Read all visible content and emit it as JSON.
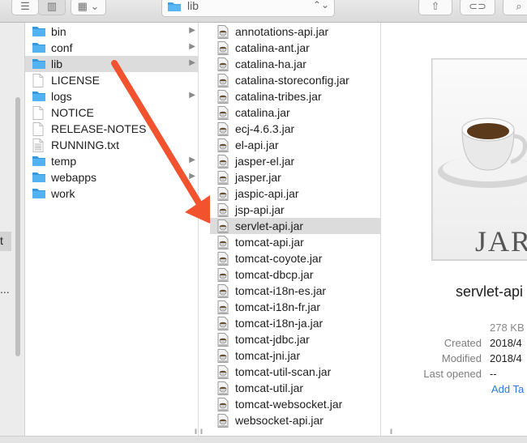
{
  "toolbar": {
    "path_name": "lib",
    "path_arrows": "◇",
    "list_view_icon": "list-view-icon",
    "column_view_icon": "column-view-icon",
    "gallery_icon": "gallery-view-icon",
    "share_icon": "share-icon",
    "tag_icon": "tag-icon",
    "search_icon": "search-icon"
  },
  "sidebar": {
    "selected_fragment": "t",
    "dots": "..."
  },
  "column1": [
    {
      "label": "bin",
      "type": "folder",
      "has_children": true
    },
    {
      "label": "conf",
      "type": "folder",
      "has_children": true
    },
    {
      "label": "lib",
      "type": "folder",
      "has_children": true,
      "selected": true
    },
    {
      "label": "LICENSE",
      "type": "file",
      "has_children": false
    },
    {
      "label": "logs",
      "type": "folder",
      "has_children": true
    },
    {
      "label": "NOTICE",
      "type": "file",
      "has_children": false
    },
    {
      "label": "RELEASE-NOTES",
      "type": "file",
      "has_children": false
    },
    {
      "label": "RUNNING.txt",
      "type": "textfile",
      "has_children": false
    },
    {
      "label": "temp",
      "type": "folder",
      "has_children": true
    },
    {
      "label": "webapps",
      "type": "folder",
      "has_children": true
    },
    {
      "label": "work",
      "type": "folder",
      "has_children": false
    }
  ],
  "column2": [
    "annotations-api.jar",
    "catalina-ant.jar",
    "catalina-ha.jar",
    "catalina-storeconfig.jar",
    "catalina-tribes.jar",
    "catalina.jar",
    "ecj-4.6.3.jar",
    "el-api.jar",
    "jasper-el.jar",
    "jasper.jar",
    "jaspic-api.jar",
    "jsp-api.jar",
    "servlet-api.jar",
    "tomcat-api.jar",
    "tomcat-coyote.jar",
    "tomcat-dbcp.jar",
    "tomcat-i18n-es.jar",
    "tomcat-i18n-fr.jar",
    "tomcat-i18n-ja.jar",
    "tomcat-jdbc.jar",
    "tomcat-jni.jar",
    "tomcat-util-scan.jar",
    "tomcat-util.jar",
    "tomcat-websocket.jar",
    "websocket-api.jar"
  ],
  "column2_selected": "servlet-api.jar",
  "preview": {
    "icon_text": "JAR",
    "file_name": "servlet-api",
    "size": "278 KB",
    "created_label": "Created",
    "created_value": "2018/4",
    "modified_label": "Modified",
    "modified_value": "2018/4",
    "last_opened_label": "Last opened",
    "last_opened_value": "--",
    "add_tags": "Add Ta"
  },
  "annotation": {
    "arrow_color": "#f2522e"
  }
}
